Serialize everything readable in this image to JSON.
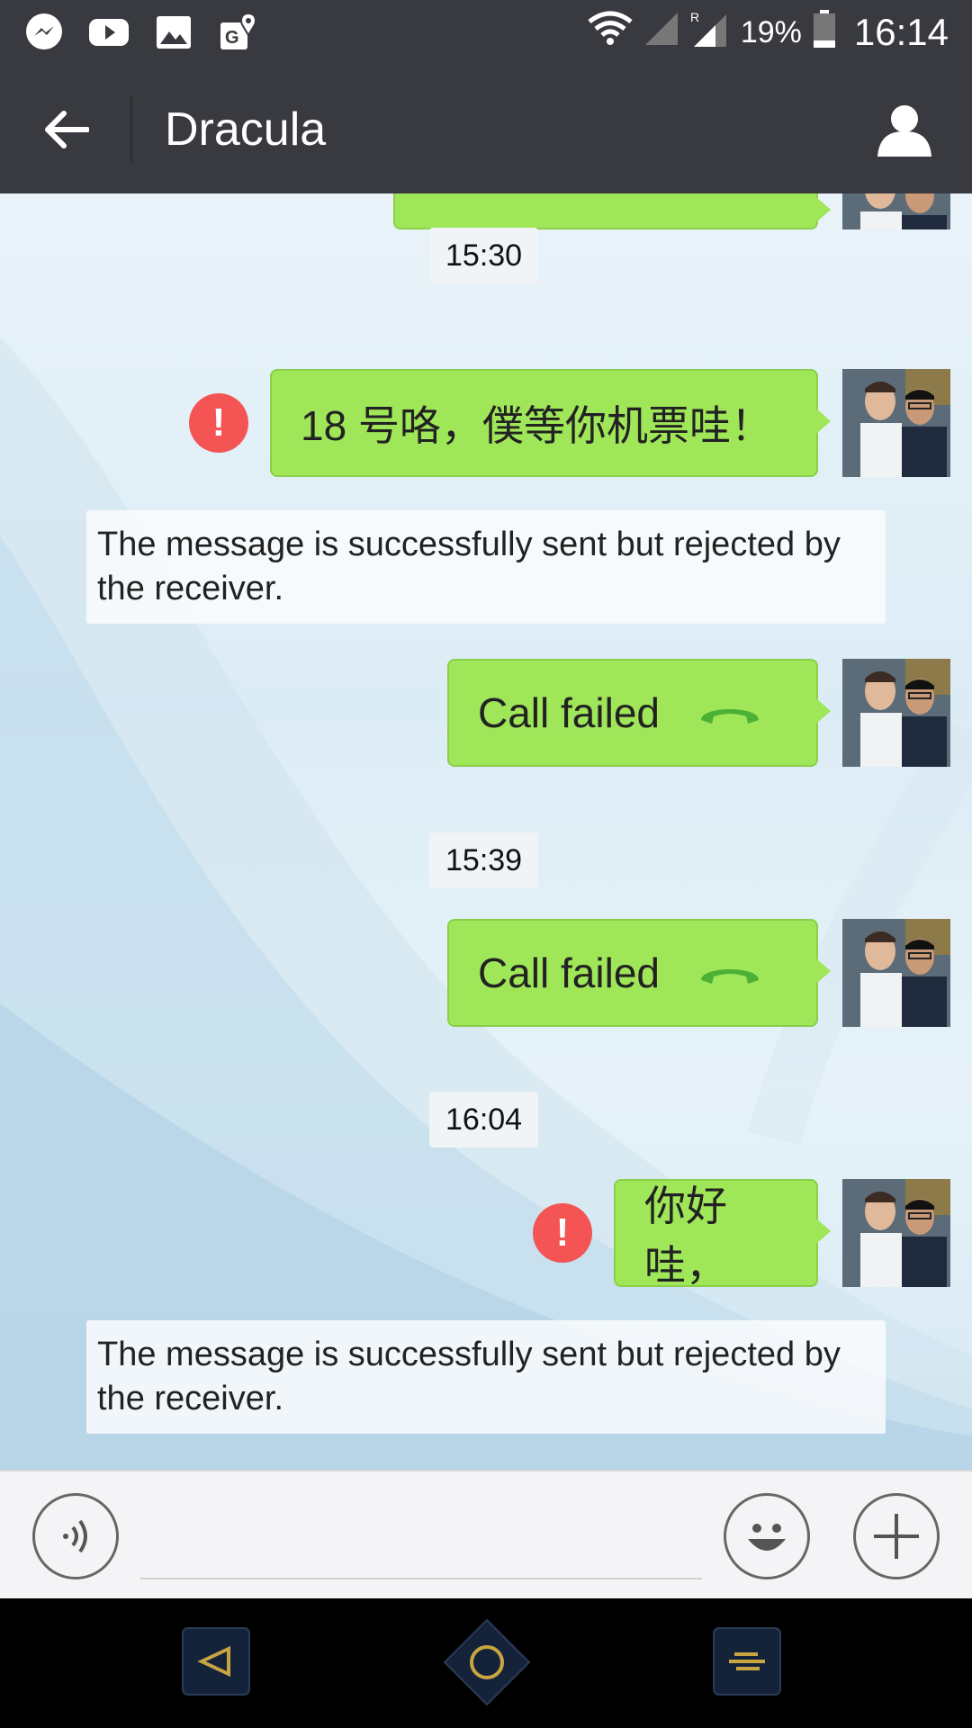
{
  "status_bar": {
    "left_icons": [
      "messenger-icon",
      "youtube-icon",
      "gallery-icon",
      "maps-icon"
    ],
    "battery": "19%",
    "time": "16:14",
    "roaming_label": "R"
  },
  "header": {
    "title": "Dracula"
  },
  "messages": [
    {
      "type": "timestamp",
      "text": "15:30"
    },
    {
      "type": "outgoing",
      "text": "18 号咯，僕等你机票哇！",
      "failed": true
    },
    {
      "type": "notice",
      "text": "The message is successfully sent but rejected by the receiver."
    },
    {
      "type": "call",
      "text": "Call failed"
    },
    {
      "type": "timestamp",
      "text": "15:39"
    },
    {
      "type": "call",
      "text": "Call failed"
    },
    {
      "type": "timestamp",
      "text": "16:04"
    },
    {
      "type": "outgoing",
      "text": "你好哇，",
      "failed": true
    },
    {
      "type": "notice",
      "text": "The message is successfully sent but rejected by the receiver."
    }
  ],
  "colors": {
    "bar_dark": "#393a3f",
    "bubble_green": "#9fe658",
    "error_red": "#f45454",
    "call_icon_green": "#4cb035"
  },
  "input": {
    "value": "",
    "placeholder": ""
  }
}
